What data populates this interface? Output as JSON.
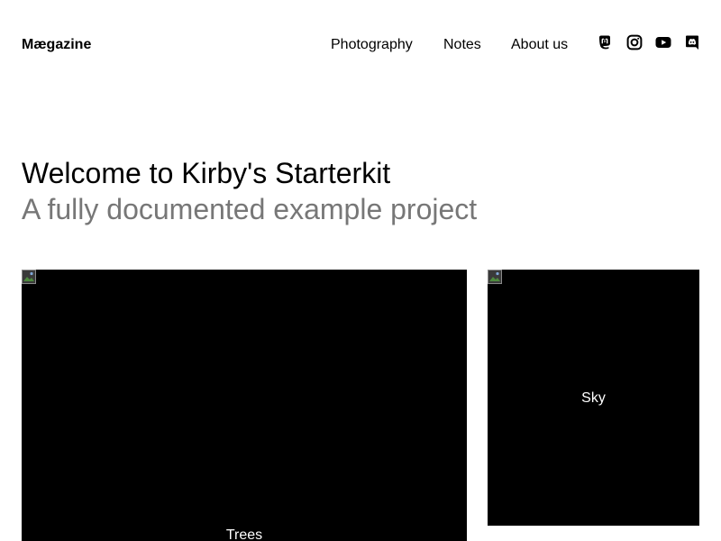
{
  "site": {
    "logo": "Mægazine"
  },
  "nav": {
    "items": [
      {
        "label": "Photography"
      },
      {
        "label": "Notes"
      },
      {
        "label": "About us"
      }
    ]
  },
  "social": {
    "icons": [
      "mastodon-icon",
      "instagram-icon",
      "youtube-icon",
      "discord-icon"
    ]
  },
  "intro": {
    "title": "Welcome to Kirby's Starterkit",
    "subtitle": "A fully documented example project"
  },
  "albums": [
    {
      "caption": "Trees"
    },
    {
      "caption": "Sky"
    }
  ],
  "colors": {
    "text": "#000000",
    "muted": "#777777",
    "tile_background": "#000000",
    "caption": "#ffffff"
  }
}
